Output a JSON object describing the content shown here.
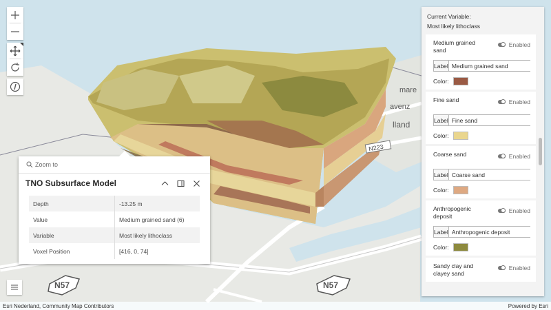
{
  "map": {
    "labels": [
      "N57",
      "N57",
      "N223",
      "lland",
      "avenz",
      "mare"
    ],
    "colors": {
      "water": "#cfe3ec",
      "land": "#e7e8e4",
      "road": "#ffffff"
    }
  },
  "toolbar": {
    "zoom_in_icon": "plus-icon",
    "zoom_out_icon": "minus-icon",
    "pan_icon": "move-icon",
    "rotate_icon": "rotate-icon",
    "compass_icon": "compass-icon",
    "expand_icon": "hamburger-icon"
  },
  "popup": {
    "zoom_to": "Zoom to",
    "title": "TNO Subsurface Model",
    "attributes": [
      {
        "key": "Depth",
        "value": "-13.25 m"
      },
      {
        "key": "Value",
        "value": "Medium grained sand (6)"
      },
      {
        "key": "Variable",
        "value": "Most likely lithoclass"
      },
      {
        "key": "Voxel Position",
        "value": "[416, 0, 74]"
      }
    ]
  },
  "panel": {
    "current_variable_label": "Current Variable:",
    "current_variable": "Most likely lithoclass",
    "label_tag": "Label",
    "color_label": "Color:",
    "enabled_text": "Enabled",
    "classes": [
      {
        "name": "Medium grained sand",
        "label": "Medium grained sand",
        "color": "#9a5a44"
      },
      {
        "name": "Fine sand",
        "label": "Fine sand",
        "color": "#ead68e"
      },
      {
        "name": "Coarse sand",
        "label": "Coarse sand",
        "color": "#dea982"
      },
      {
        "name": "Anthropogenic deposit",
        "label": "Anthropogenic deposit",
        "color": "#8d8a3e"
      },
      {
        "name": "Sandy clay and clayey sand",
        "label": "",
        "color": ""
      }
    ]
  },
  "attribution": {
    "left": "Esri Nederland, Community Map Contributors",
    "right": "Powered by Esri"
  }
}
